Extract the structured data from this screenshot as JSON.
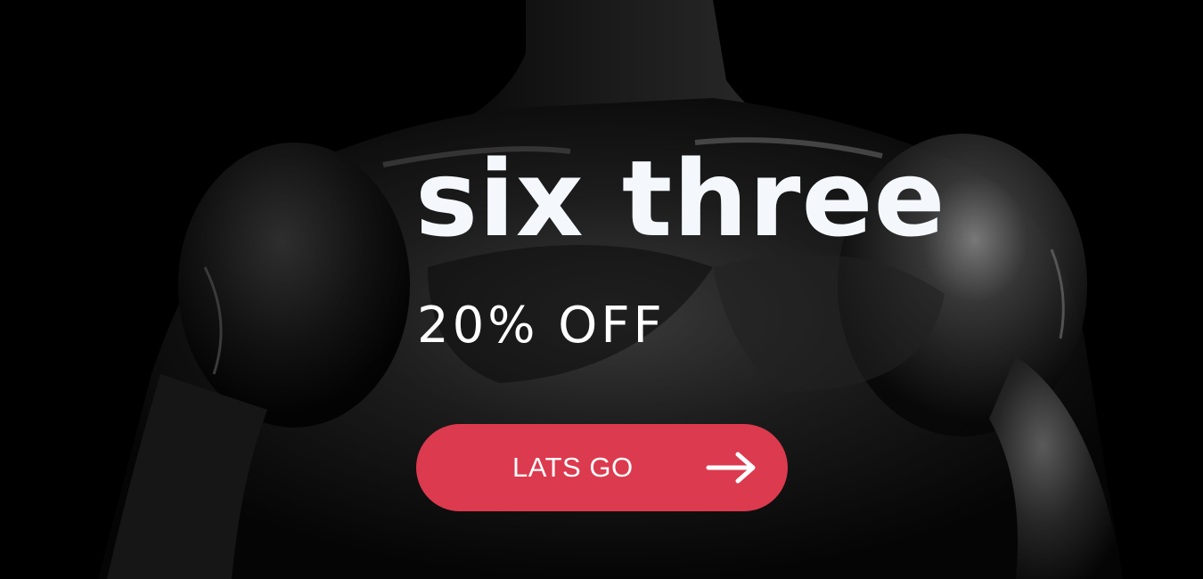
{
  "hero": {
    "headline": "six three",
    "subheadline": "20% OFF",
    "background_image": "muscular-torso-photo",
    "cta": {
      "label": "LATS GO",
      "icon": "arrow-right-icon",
      "color": "#dc3a4e"
    }
  },
  "colors": {
    "background": "#000000",
    "headline": "#f4f8fd",
    "text": "#ffffff",
    "accent": "#dc3a4e"
  }
}
